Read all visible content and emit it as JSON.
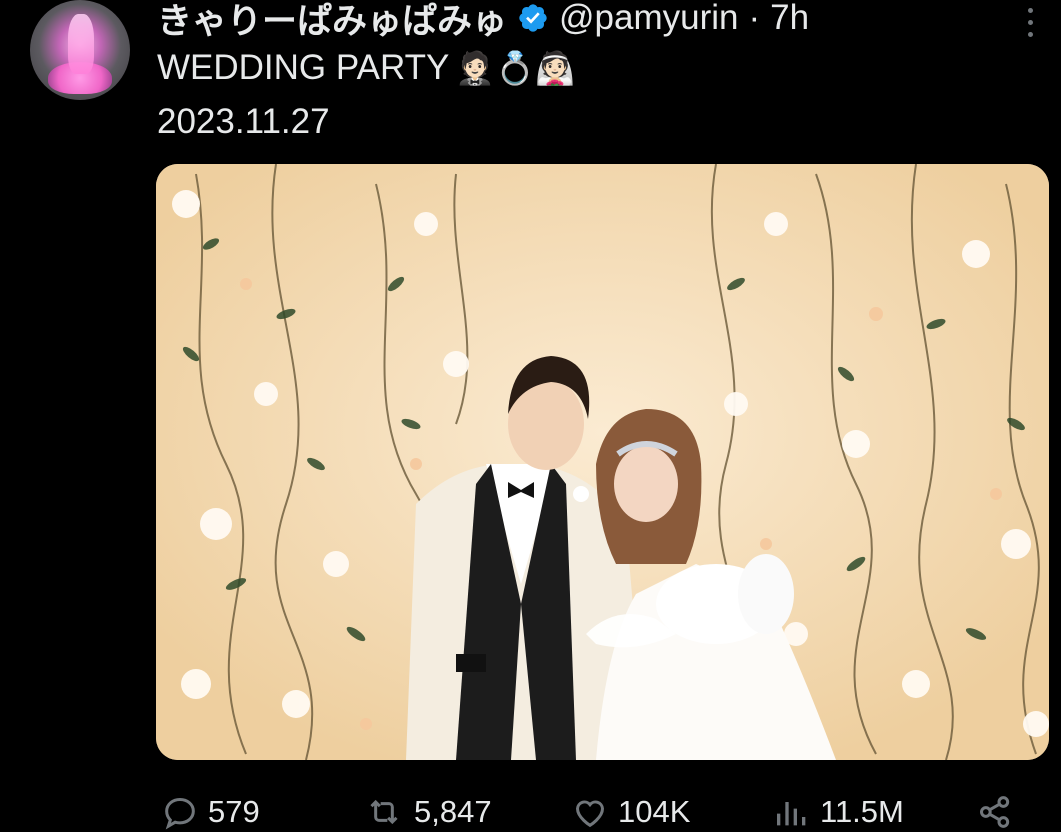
{
  "author": {
    "display_name": "きゃりーぱみゅぱみゅ",
    "handle": "@pamyurin",
    "separator": "·",
    "time": "7h"
  },
  "tweet": {
    "text_line1": "WEDDING PARTY",
    "text_line1_emoji": "🤵🏻💍👰🏻",
    "text_line2": "2023.11.27"
  },
  "actions": {
    "replies": "579",
    "retweets": "5,847",
    "likes": "104K",
    "views": "11.5M"
  },
  "icons": {
    "verified": "verified-badge-icon",
    "more": "more-dots-icon",
    "reply": "reply-icon",
    "retweet": "retweet-icon",
    "like": "heart-icon",
    "views": "views-icon",
    "share": "share-icon"
  },
  "colors": {
    "background": "#000000",
    "text": "#e7e9ea",
    "muted": "#71767b",
    "verified": "#1d9bf0"
  }
}
